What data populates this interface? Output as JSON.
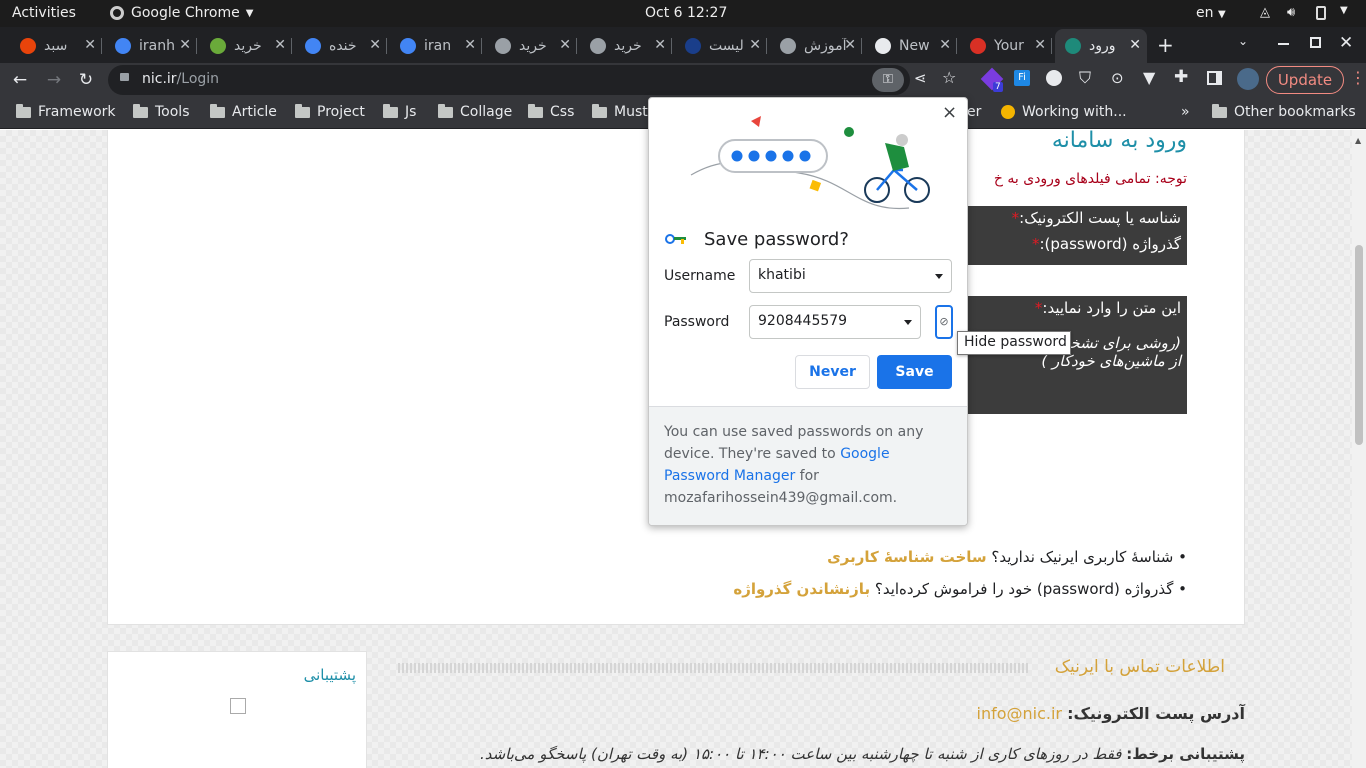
{
  "system_bar": {
    "activities": "Activities",
    "app_name": "Google Chrome",
    "clock": "Oct 6  12:27",
    "language": "en"
  },
  "tabs": [
    {
      "title": "سبد",
      "icon": "record-icon",
      "color": "#e8440b"
    },
    {
      "title": "iranh",
      "icon": "google-icon",
      "color": "#4285f4"
    },
    {
      "title": "خرید",
      "icon": "globe-icon",
      "color": "#6aaa3a"
    },
    {
      "title": "خنده",
      "icon": "google-icon",
      "color": "#4285f4"
    },
    {
      "title": "iran",
      "icon": "google-icon",
      "color": "#4285f4"
    },
    {
      "title": "خرید",
      "icon": "server-icon",
      "color": "#9aa0a6"
    },
    {
      "title": "خرید",
      "icon": "server-icon",
      "color": "#9aa0a6"
    },
    {
      "title": "لیست",
      "icon": "circle-icon",
      "color": "#1a3e8a"
    },
    {
      "title": "آموزش",
      "icon": "server-icon",
      "color": "#9aa0a6"
    },
    {
      "title": "New",
      "icon": "chrome-icon",
      "color": "#e8eaed"
    },
    {
      "title": "Your",
      "icon": "gmail-icon",
      "color": "#d93025"
    },
    {
      "title": "ورود",
      "icon": "nic-icon",
      "color": "#1e8a7a",
      "active": true
    }
  ],
  "toolbar": {
    "url_host": "nic.ir",
    "url_path": "/Login",
    "update_label": "Update",
    "ext_badge": "7"
  },
  "bookmarks": [
    "Framework",
    "Tools",
    "Article",
    "Project",
    "Js",
    "Collage",
    "Css",
    "Mustr"
  ],
  "bookmarks_right": {
    "working": "Working with...",
    "chevron": "»",
    "other": "Other bookmarks",
    "partial": "er"
  },
  "page": {
    "heading": "ورود به سامانه",
    "notice": "توجه: تمامی فیلدهای ورودی به خ",
    "username_label": "شناسه یا پست الکترونیک:",
    "password_label": "گذرواژه (password):",
    "captcha_label": "این متن را وارد نمایید:",
    "captcha_hint_1": "(روشی برای تشخیص",
    "captcha_hint_2": "از ماشین‌های خودکار )",
    "no_account_text": "شناسهٔ کاربری ایرنیک ندارید؟",
    "no_account_link": "ساخت شناسهٔ کاربری",
    "forgot_text": "گذرواژه (password) خود را فراموش کرده‌اید؟",
    "forgot_link": "بازنشاندن گذرواژه",
    "contact_title": "اطلاعات تماس با ایرنیک",
    "email_label": "آدرس پست الکترونیک:",
    "email_value": "info@nic.ir",
    "support_label": "پشتیبانی برخط:",
    "support_text": "فقط در روزهای کاری از شنبه تا چهارشنبه بین ساعت ۱۴:۰۰ تا ۱۵:۰۰ (به وقت تهران) پاسخگو می‌باشد.",
    "support_box_title": "پشتیبانی",
    "required_mark": "*"
  },
  "dialog": {
    "title": "Save password?",
    "username_label": "Username",
    "username_value": "khatibi",
    "password_label": "Password",
    "password_value": "9208445579",
    "never_label": "Never",
    "save_label": "Save",
    "footer_text": "You can use saved passwords on any device. They're saved to",
    "footer_link": "Google Password Manager",
    "footer_for": "for",
    "footer_email": "mozafarihossein439@gmail.com.",
    "close": "×",
    "accent": "#1a73e8"
  },
  "tooltip": {
    "text": "Hide password"
  }
}
